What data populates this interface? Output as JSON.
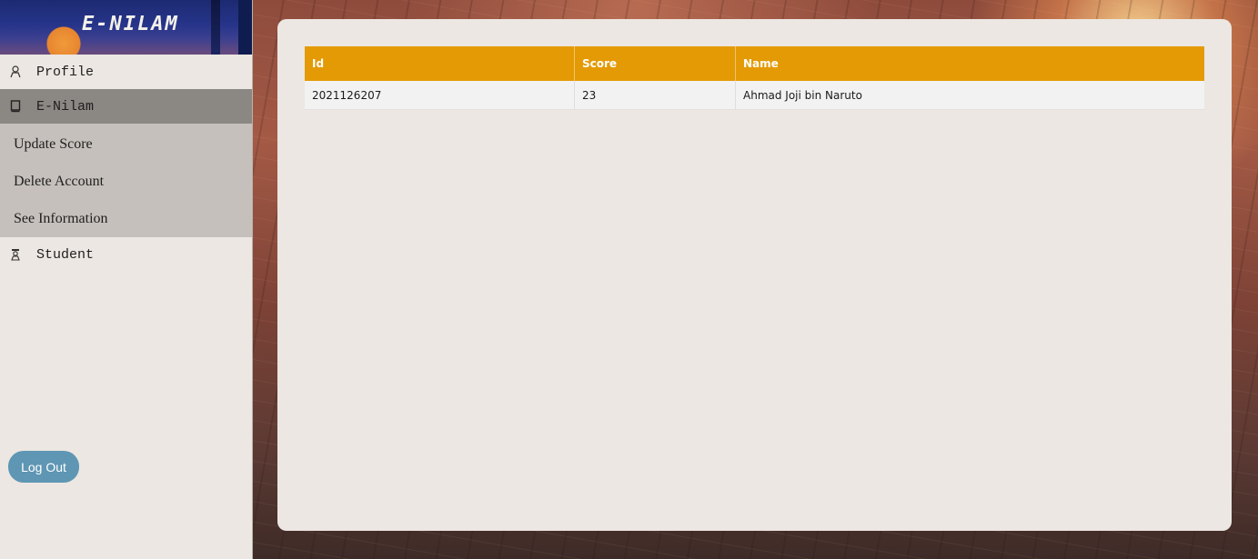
{
  "brand": {
    "title": "E-NILAM"
  },
  "sidebar": {
    "items": [
      {
        "label": "Profile",
        "icon": "user-icon"
      },
      {
        "label": "E-Nilam",
        "icon": "book-icon",
        "active": true
      },
      {
        "label": "Student",
        "icon": "student-icon"
      }
    ],
    "submenu": [
      {
        "label": "Update Score"
      },
      {
        "label": "Delete Account"
      },
      {
        "label": "See Information"
      }
    ],
    "logout_label": "Log Out"
  },
  "table": {
    "headers": [
      "Id",
      "Score",
      "Name"
    ],
    "rows": [
      [
        "2021126207",
        "23",
        "Ahmad Joji bin Naruto"
      ]
    ]
  },
  "colors": {
    "header_accent": "#e49a04",
    "logout_button": "#5e96b3",
    "active_nav": "#8b8783",
    "submenu_bg": "#c5c0bb"
  }
}
